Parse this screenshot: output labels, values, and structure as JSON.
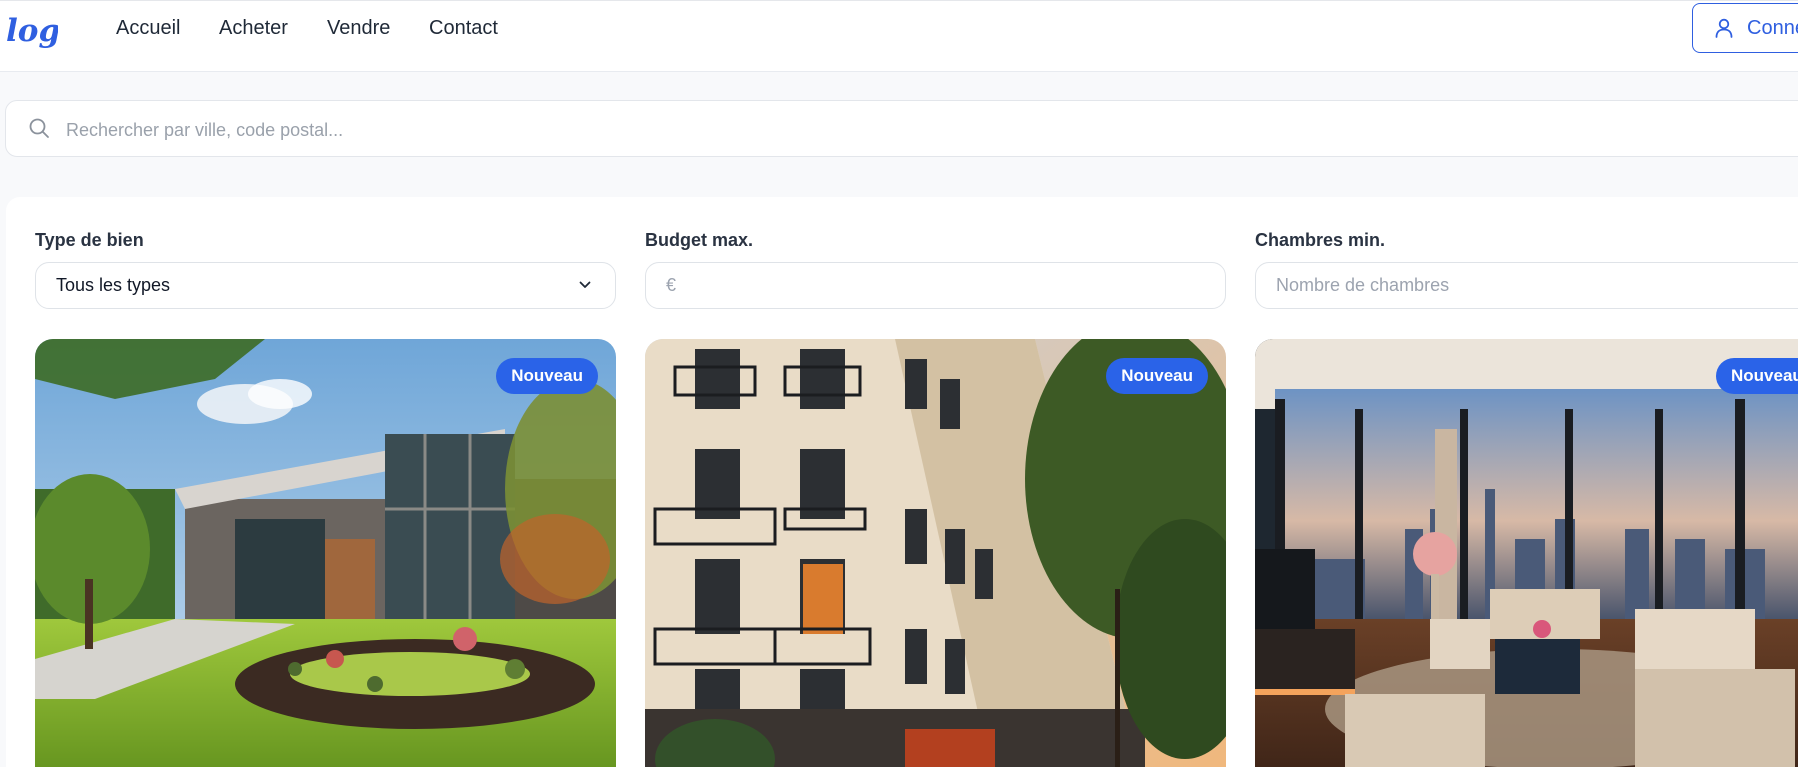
{
  "header": {
    "logo_text": "logo",
    "nav": [
      {
        "label": "Accueil"
      },
      {
        "label": "Acheter"
      },
      {
        "label": "Vendre"
      },
      {
        "label": "Contact"
      }
    ],
    "login_label": "Connexion"
  },
  "search": {
    "placeholder": "Rechercher par ville, code postal...",
    "icon": "search-icon"
  },
  "filters": {
    "type": {
      "label": "Type de bien",
      "value": "Tous les types"
    },
    "budget": {
      "label": "Budget max.",
      "placeholder": "€"
    },
    "bedrooms": {
      "label": "Chambres min.",
      "placeholder": "Nombre de chambres"
    }
  },
  "listings": [
    {
      "badge": "Nouveau",
      "image": "modern-house-with-garden"
    },
    {
      "badge": "Nouveau",
      "image": "haussmann-apartment-building"
    },
    {
      "badge": "Nouveau",
      "image": "penthouse-living-room-city-view"
    }
  ],
  "colors": {
    "accent": "#2a63e8",
    "page_background": "#f8f9fb"
  }
}
